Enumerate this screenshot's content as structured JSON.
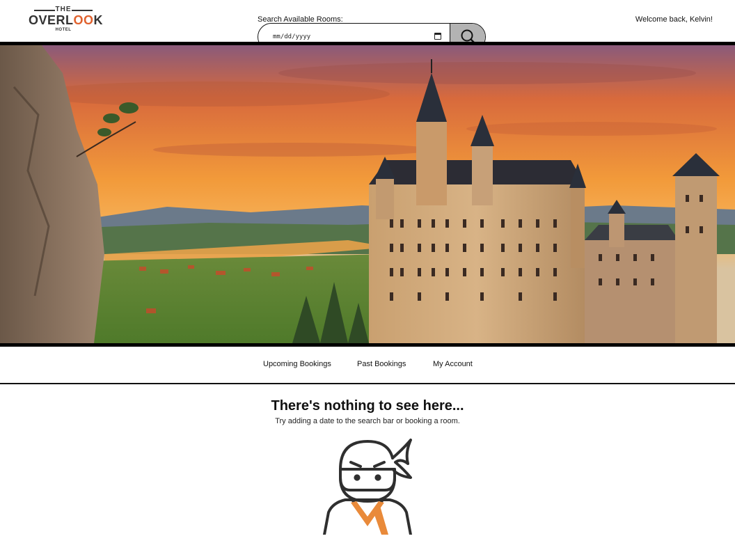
{
  "header": {
    "logo": {
      "the": "THE",
      "word_start": "OVERL",
      "word_oo": "OO",
      "word_end": "K",
      "hotel": "HOTEL"
    },
    "search": {
      "label": "Search Available Rooms:",
      "date_placeholder": "mm/dd/yyyy",
      "button_icon": "search-icon"
    },
    "welcome": "Welcome back, Kelvin!"
  },
  "hero": {
    "icon": "castle-sunset-photo"
  },
  "tabs": [
    {
      "label": "Upcoming Bookings"
    },
    {
      "label": "Past Bookings"
    },
    {
      "label": "My Account"
    }
  ],
  "empty_state": {
    "title": "There's nothing to see here...",
    "subtitle": "Try adding a date to the search bar or booking a room.",
    "illustration": "ninja-icon"
  },
  "colors": {
    "accent": "#e0612d",
    "search_button": "#b3b3b3",
    "rule": "#000000"
  }
}
